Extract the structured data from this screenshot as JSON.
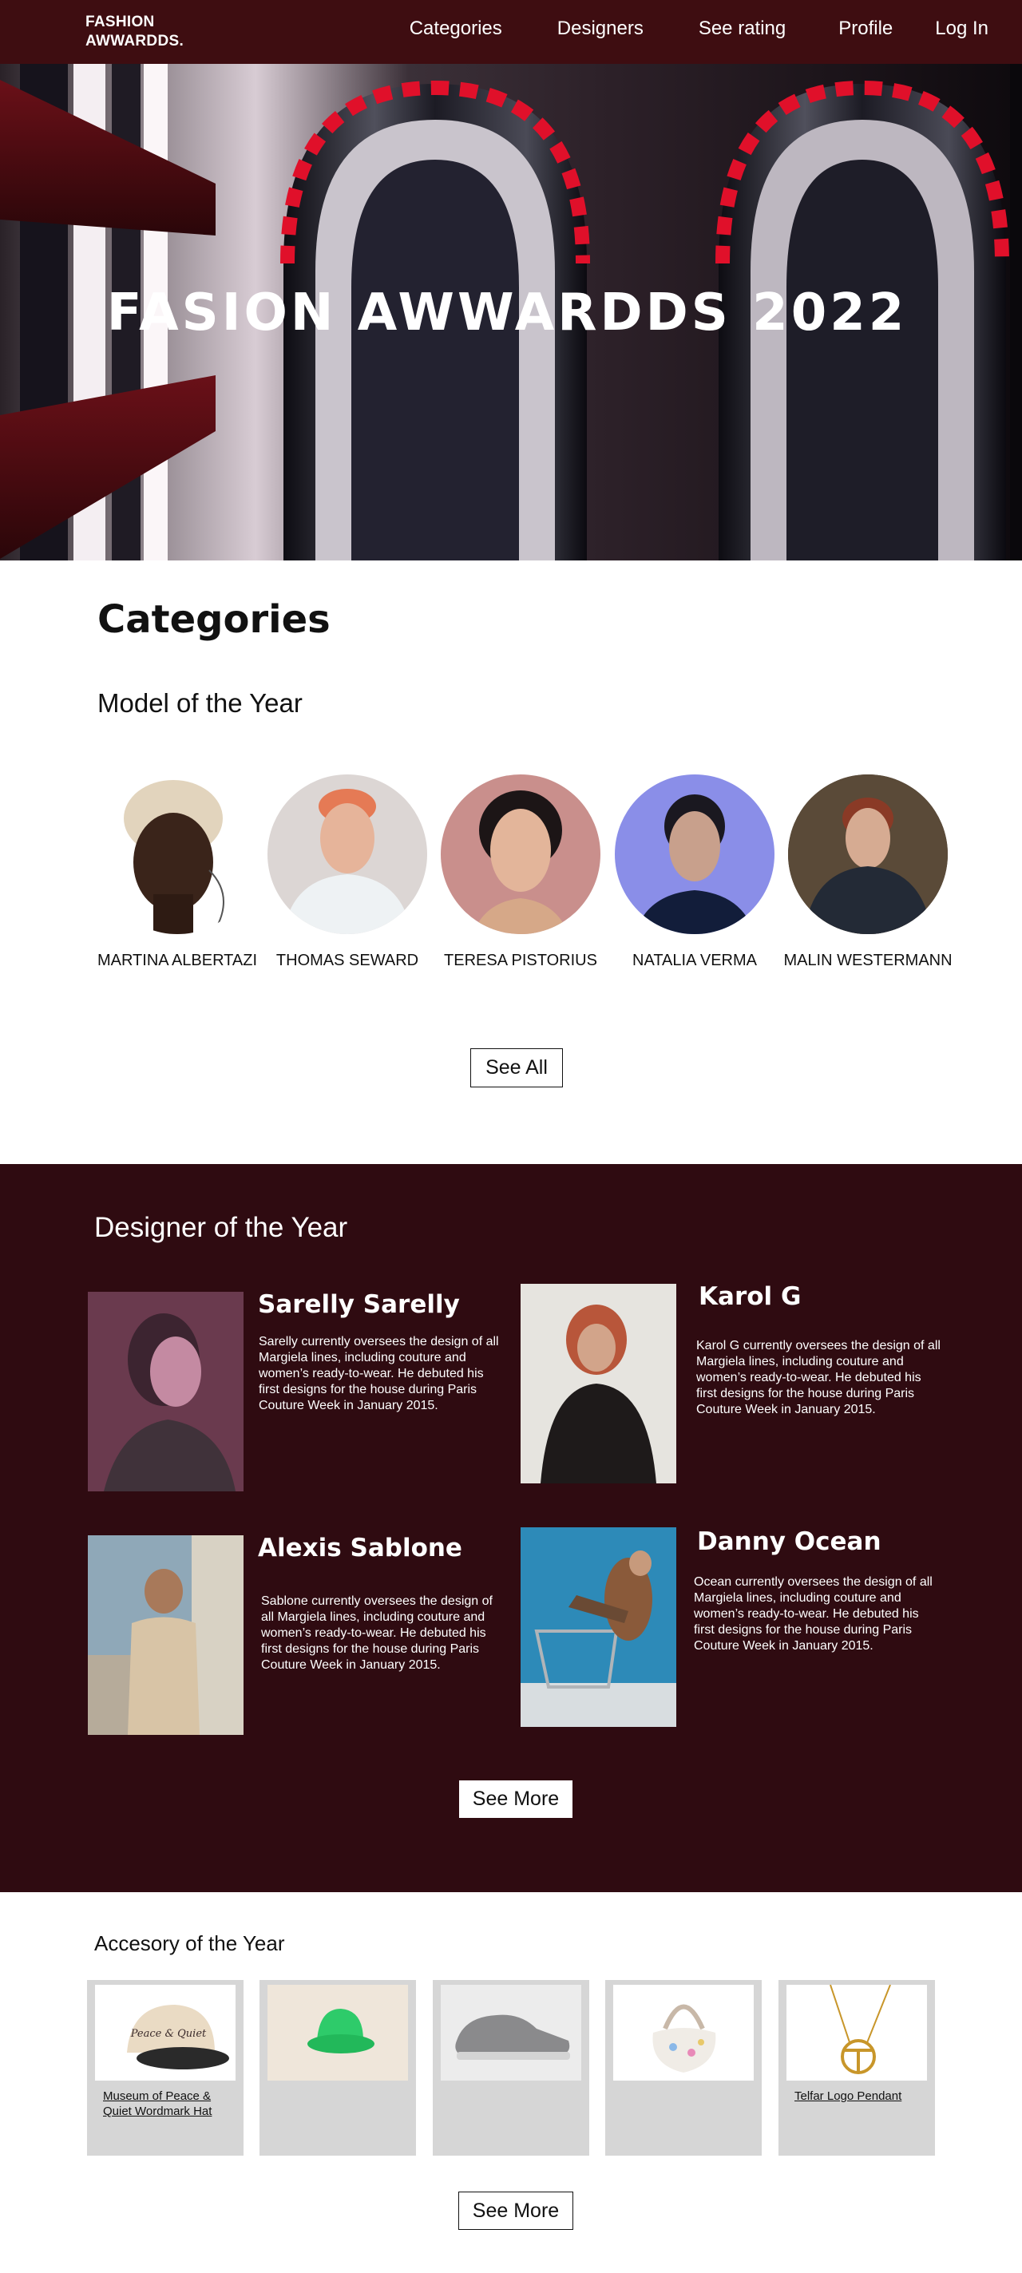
{
  "nav": {
    "logo_line1": "FASHION",
    "logo_line2": "AWWARDDS.",
    "links": [
      "Categories",
      "Designers",
      "See rating",
      "Profile",
      "Log In"
    ]
  },
  "hero": {
    "title": "FASION AWWARDDS 2022"
  },
  "categories": {
    "heading": "Categories",
    "subheading": "Model of the Year",
    "models": [
      {
        "name": "MARTINA ALBERTAZI"
      },
      {
        "name": "THOMAS SEWARD"
      },
      {
        "name": "TERESA PISTORIUS"
      },
      {
        "name": "NATALIA VERMA"
      },
      {
        "name": "MALIN WESTERMANN"
      }
    ],
    "see_all": "See All"
  },
  "designers": {
    "heading": "Designer of the Year",
    "items": [
      {
        "name": "Sarelly Sarelly",
        "desc": "Sarelly currently oversees the design of all Margiela lines, including couture and women’s ready-to-wear. He debuted his first designs for the house during Paris Couture Week in January 2015."
      },
      {
        "name": "Karol G",
        "desc": "Karol G currently oversees the design of all Margiela lines, including couture and women’s ready-to-wear. He debuted his first designs for the house during Paris Couture Week in January 2015."
      },
      {
        "name": "Alexis Sablone",
        "desc": "Sablone currently oversees the design of all Margiela lines, including couture and women’s ready-to-wear. He debuted his first designs for the house during Paris Couture Week in January 2015."
      },
      {
        "name": "Danny Ocean",
        "desc": "Ocean currently oversees the design of all Margiela lines, including couture and women’s ready-to-wear. He debuted his first designs for the house during Paris Couture Week in January 2015."
      }
    ],
    "see_more": "See More"
  },
  "accessories": {
    "heading": "Accesory of the Year",
    "items": [
      {
        "label": "Museum of Peace & Quiet Wordmark Hat",
        "cap_text": "Peace & Quiet"
      },
      {
        "label": ""
      },
      {
        "label": ""
      },
      {
        "label": ""
      },
      {
        "label": "Telfar Logo Pendant"
      }
    ],
    "see_more": "See More"
  },
  "colors": {
    "nav_bg": "#3e0d11",
    "designers_bg": "#2f0b11",
    "card_bg": "#d6d6d6"
  }
}
